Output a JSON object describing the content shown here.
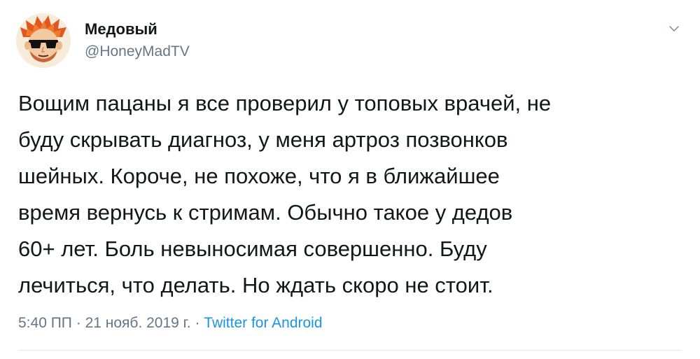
{
  "author": {
    "display_name": "Медовый",
    "handle": "@HoneyMadTV",
    "avatar_icon": "cartoon-face-sunglasses-avatar"
  },
  "tweet": {
    "text": "Вощим пацаны я все проверил у топовых врачей, не\nбуду скрывать диагноз, у меня артроз позвонков\nшейных. Короче, не похоже, что я в ближайшее\nвремя вернусь к стримам. Обычно такое у дедов\n60+ лет. Боль невыносимая совершенно. Буду\nлечиться, что делать. Но ждать скоро не стоит."
  },
  "meta": {
    "time": "5:40 ПП",
    "separator_1": " · ",
    "date": "21 нояб. 2019 г.",
    "separator_2": " · ",
    "source": "Twitter for Android"
  },
  "icons": {
    "menu": "chevron-down-icon"
  },
  "colors": {
    "name": "#14171a",
    "secondary": "#657786",
    "link": "#1b95e0",
    "divider": "#e1e8ed"
  }
}
